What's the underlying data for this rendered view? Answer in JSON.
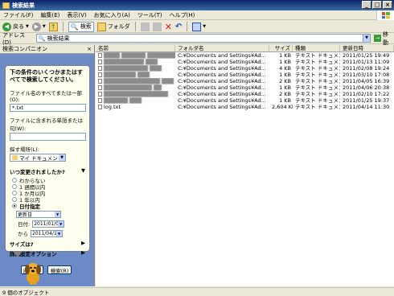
{
  "window": {
    "title": "検索結果"
  },
  "menu": [
    "ファイル(F)",
    "編集(E)",
    "表示(V)",
    "お気に入り(A)",
    "ツール(T)",
    "ヘルプ(H)"
  ],
  "toolbar": {
    "back": "戻る",
    "search": "検索",
    "folders": "フォルダ"
  },
  "address": {
    "label": "アドレス(D)",
    "value": "検索結果",
    "go": "移動"
  },
  "pane": {
    "header": "検索コンパニオン",
    "intro": "下の条件のいくつかまたはすべてで検索してください。",
    "name_label": "ファイル名のすべてまたは一部(O):",
    "name_value": "*.txt",
    "word_label": "ファイルに含まれる単語または句(W):",
    "word_value": "",
    "location_label": "探す場所(L):",
    "location_value": "マイ ドキュメント",
    "when_label": "いつ変更されましたか?",
    "options": [
      "わからない",
      "1 週間以内",
      "1 か月以内",
      "1 年以内",
      "日付指定"
    ],
    "selected_option": 4,
    "date_type": "更新日",
    "from_label": "日付:",
    "from_value": "2011/01/01",
    "to_label": "から",
    "to_value": "2011/04/14",
    "size_label": "サイズは?",
    "advanced_label": "詳細設定オプション",
    "back_button": "戻る(B)",
    "search_button": "検索(R)"
  },
  "columns": {
    "name": "名前",
    "folder": "フォルダ名",
    "size": "サイズ",
    "type": "種類",
    "date": "更新日時"
  },
  "files": [
    {
      "name": "████ ██████ ████████ ██ ██",
      "folder": "C:¥Documents and Settings¥Ad...",
      "size": "1 KB",
      "type": "テキスト ドキュメント",
      "date": "2011/01/25 19:49"
    },
    {
      "name": "██████████ ███",
      "folder": "C:¥Documents and Settings¥Ad...",
      "size": "1 KB",
      "type": "テキスト ドキュメント",
      "date": "2011/01/13 11:09"
    },
    {
      "name": "███████████ ███",
      "folder": "C:¥Documents and Settings¥Ad...",
      "size": "4 KB",
      "type": "テキスト ドキュメント",
      "date": "2011/02/08 19:24"
    },
    {
      "name": "████████ ███",
      "folder": "C:¥Documents and Settings¥Ad...",
      "size": "1 KB",
      "type": "テキスト ドキュメント",
      "date": "2011/03/10 17:08"
    },
    {
      "name": "██████████████ ███",
      "folder": "C:¥Documents and Settings¥Ad...",
      "size": "2 KB",
      "type": "テキスト ドキュメント",
      "date": "2011/04/05 16:39"
    },
    {
      "name": "████████████ ██",
      "folder": "C:¥Documents and Settings¥Ad...",
      "size": "1 KB",
      "type": "テキスト ドキュメント",
      "date": "2011/04/06 20:38"
    },
    {
      "name": "████████████████",
      "folder": "C:¥Documents and Settings¥Ad...",
      "size": "2 KB",
      "type": "テキスト ドキュメント",
      "date": "2011/02/10 17:22"
    },
    {
      "name": "██████ ███",
      "folder": "C:¥Documents and Settings¥Ad...",
      "size": "1 KB",
      "type": "テキスト ドキュメント",
      "date": "2011/01/25 19:37"
    },
    {
      "name": "log.txt",
      "folder": "C:¥Documents and Settings¥Ad...",
      "size": "2,604 KB",
      "type": "テキスト ドキュメント",
      "date": "2011/04/14 11:30"
    }
  ],
  "status": "9 個のオブジェクト"
}
